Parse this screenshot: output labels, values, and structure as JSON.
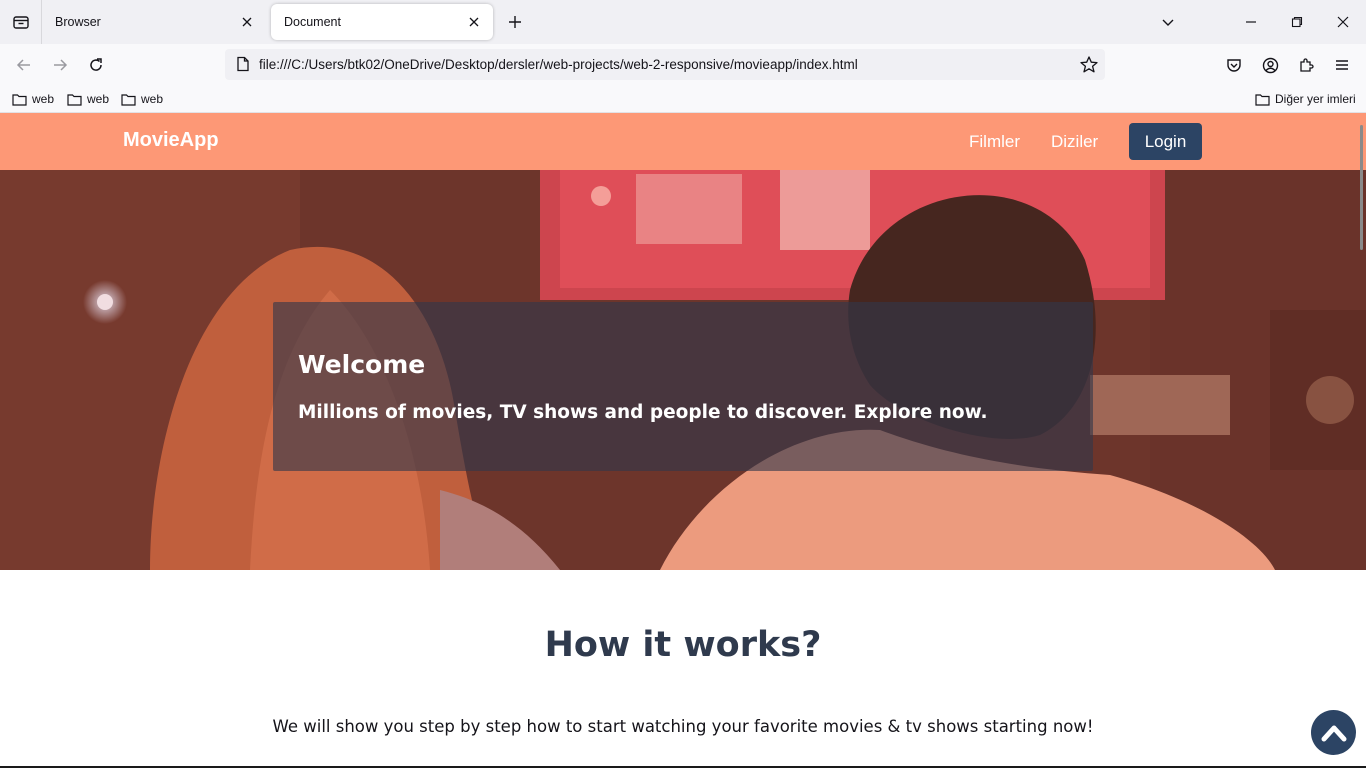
{
  "browser": {
    "tabs": [
      {
        "title": "Browser",
        "active": false
      },
      {
        "title": "Document",
        "active": true
      }
    ],
    "url": "file:///C:/Users/btk02/OneDrive/Desktop/dersler/web-projects/web-2-responsive/movieapp/index.html",
    "bookmarks": [
      "web",
      "web",
      "web"
    ],
    "other_bookmarks": "Diğer yer imleri"
  },
  "site": {
    "brand": "MovieApp",
    "menu": [
      "Filmler",
      "Diziler"
    ],
    "login": "Login",
    "colors": {
      "header": "#fd9876",
      "login": "#2c4464"
    }
  },
  "hero": {
    "title": "Welcome",
    "subtitle": "Millions of movies, TV shows and people to discover. Explore now."
  },
  "how": {
    "title": "How it works?",
    "subtitle": "We will show you step by step how to start watching your favorite movies & tv shows starting now!"
  },
  "icons": {
    "scroll_top": "chevron-up-icon"
  }
}
